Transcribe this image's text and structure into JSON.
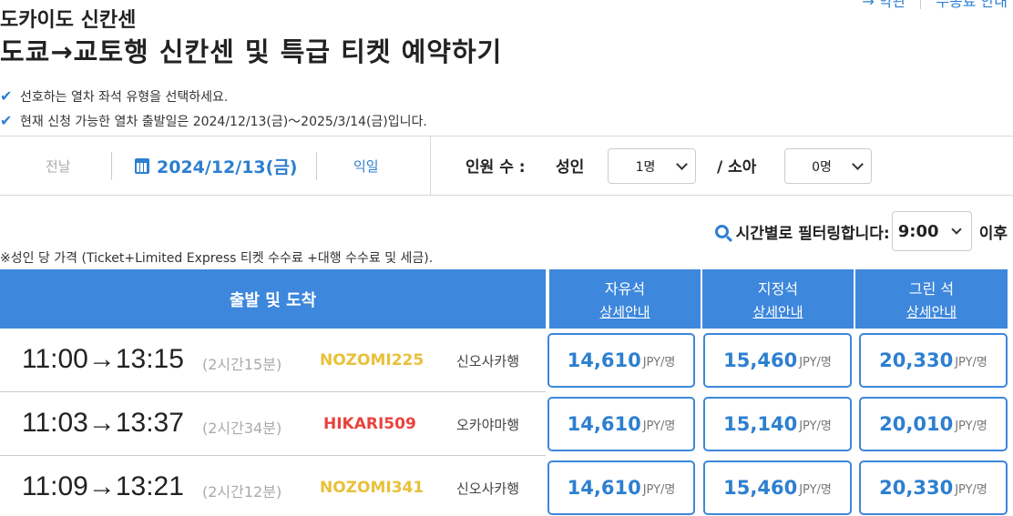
{
  "top_links": {
    "left": "→ 약관",
    "right": "수송료 안내"
  },
  "header": {
    "subtitle": "도카이도 신칸센",
    "title": "도쿄→교토행 신칸센 및 특급 티켓 예약하기"
  },
  "notes": [
    "선호하는 열차 좌석 유형을 선택하세요.",
    "현재 신청 가능한 열차 출발일은 2024/12/13(금)～2025/3/14(금)입니다."
  ],
  "datebar": {
    "prev": "전날",
    "date": "2024/12/13(금)",
    "next": "익일",
    "passengers_label": "인원 수 :",
    "adult_label": "성인",
    "adult_value": "1명",
    "child_label": "/ 소아",
    "child_value": "0명"
  },
  "filter": {
    "label": "시간별로 필터링합니다:",
    "value": "9:00",
    "suffix": "이후"
  },
  "price_note": "※성인 당 가격 (Ticket+Limited Express 티켓 수수료 +대행 수수료 및 세금).",
  "table": {
    "route_header": "출발 및 도착",
    "classes": [
      {
        "name": "자유석",
        "info": "상세안내"
      },
      {
        "name": "지정석",
        "info": "상세안내"
      },
      {
        "name": "그린 석",
        "info": "상세안내"
      }
    ],
    "unit": "JPY/명",
    "rows": [
      {
        "times": "11:00→13:15",
        "duration": "(2시간15분)",
        "train": "NOZOMI225",
        "station": "신오사카행",
        "prices": [
          "14,610",
          "15,460",
          "20,330"
        ]
      },
      {
        "times": "11:03→13:37",
        "duration": "(2시간34분)",
        "train": "HIKARI509",
        "station": "오카야마행",
        "prices": [
          "14,610",
          "15,140",
          "20,010"
        ]
      },
      {
        "times": "11:09→13:21",
        "duration": "(2시간12분)",
        "train": "NOZOMI341",
        "station": "신오사카행",
        "prices": [
          "14,610",
          "15,460",
          "20,330"
        ]
      }
    ]
  },
  "colors": {
    "accent": "#3d87dc",
    "nozomi": "#e8c13a",
    "hikari": "#e8433d"
  }
}
